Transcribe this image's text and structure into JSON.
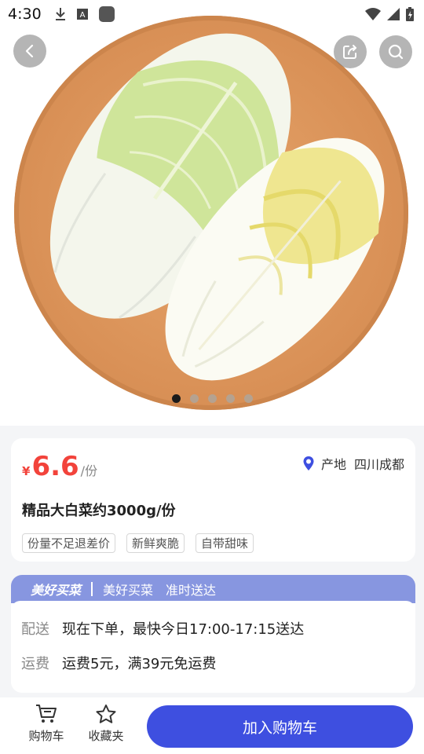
{
  "status_bar": {
    "time": "4:30",
    "icons": [
      "download-icon",
      "font-icon",
      "app-icon",
      "wifi-icon",
      "signal-icon",
      "battery-icon"
    ]
  },
  "hero": {
    "image_description_icon": "chinese-cabbage-photo",
    "carousel": {
      "count": 5,
      "active_index": 0
    },
    "buttons": {
      "back": "back-icon",
      "share": "share-icon",
      "search": "search-icon"
    }
  },
  "product": {
    "price_symbol": "¥",
    "price_value": "6.6",
    "price_unit": "/份",
    "origin_label": "产地",
    "origin_value": "四川成都",
    "title": "精品大白菜约3000g/份",
    "tags": [
      "份量不足退差价",
      "新鲜爽脆",
      "自带甜味"
    ]
  },
  "delivery": {
    "brand": "美好买菜",
    "slogan": "美好买菜　准时送达",
    "rows": [
      {
        "label": "配送",
        "value": "现在下单，最快今日17:00-17:15送达"
      },
      {
        "label": "运费",
        "value": "运费5元，满39元免运费"
      }
    ]
  },
  "bottom_bar": {
    "cart_label": "购物车",
    "favorite_label": "收藏夹",
    "add_to_cart_label": "加入购物车"
  },
  "colors": {
    "price": "#f2433b",
    "primary_button": "#3e4fe0",
    "banner": "#8796e0",
    "location_pin": "#3e4fe0"
  }
}
